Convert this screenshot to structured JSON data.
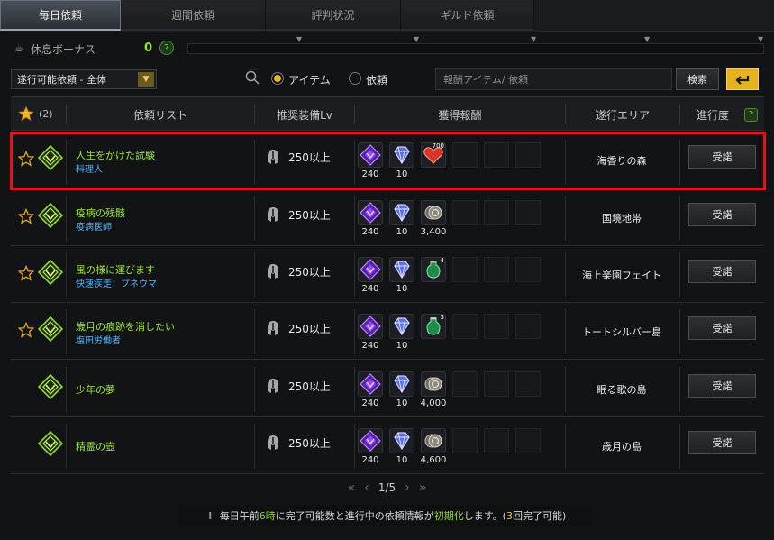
{
  "tabs": [
    "毎日依頼",
    "週間依頼",
    "評判状況",
    "ギルド依頼"
  ],
  "rest_bonus": {
    "label": "休息ボーナス",
    "value": "0",
    "help": "?"
  },
  "filter": {
    "dropdown": "遂行可能依頼 - 全体",
    "radio_item": "アイテム",
    "radio_quest": "依頼",
    "search_placeholder": "報酬アイテム/ 依頼",
    "search_button": "検索"
  },
  "header": {
    "star_count": "(2)",
    "quest_list": "依頼リスト",
    "gear": "推奨装備Lv",
    "reward": "獲得報酬",
    "area": "遂行エリア",
    "progress": "進行度",
    "help": "?"
  },
  "quests": [
    {
      "name": "人生をかけた試験",
      "sub": "料理人",
      "lv": "250以上",
      "r1": "240",
      "r2": "10",
      "r3": "",
      "r3badge": "700",
      "r3type": "heart",
      "area": "海香りの森",
      "accept": "受諾",
      "star": true
    },
    {
      "name": "疫病の残骸",
      "sub": "疫病医師",
      "lv": "250以上",
      "r1": "240",
      "r2": "10",
      "r3": "3,400",
      "r3badge": "",
      "r3type": "coin",
      "area": "国境地帯",
      "accept": "受諾",
      "star": true
    },
    {
      "name": "風の様に運びます",
      "sub": "快速疾走：プネウマ",
      "lv": "250以上",
      "r1": "240",
      "r2": "10",
      "r3": "",
      "r3badge": "4",
      "r3type": "potion",
      "area": "海上楽園フェイト",
      "accept": "受諾",
      "star": true
    },
    {
      "name": "歳月の痕跡を消したい",
      "sub": "塩田労働者",
      "lv": "250以上",
      "r1": "240",
      "r2": "10",
      "r3": "",
      "r3badge": "3",
      "r3type": "potion",
      "area": "トートシルバー島",
      "accept": "受諾",
      "star": true
    },
    {
      "name": "少年の夢",
      "sub": "",
      "lv": "250以上",
      "r1": "240",
      "r2": "10",
      "r3": "4,000",
      "r3badge": "",
      "r3type": "coin",
      "area": "眠る歌の島",
      "accept": "受諾",
      "star": false
    },
    {
      "name": "精霊の壺",
      "sub": "",
      "lv": "250以上",
      "r1": "240",
      "r2": "10",
      "r3": "4,600",
      "r3badge": "",
      "r3type": "coin",
      "area": "歳月の島",
      "accept": "受諾",
      "star": false
    }
  ],
  "pager": {
    "text": "1/5"
  },
  "notice": {
    "p1": "毎日午前",
    "p2": "6時",
    "p3": "に完了可能数と進行中の依頼情報が",
    "p4": "初期化",
    "p5": "します。(",
    "p6": "3",
    "p7": "回完了可能)"
  }
}
